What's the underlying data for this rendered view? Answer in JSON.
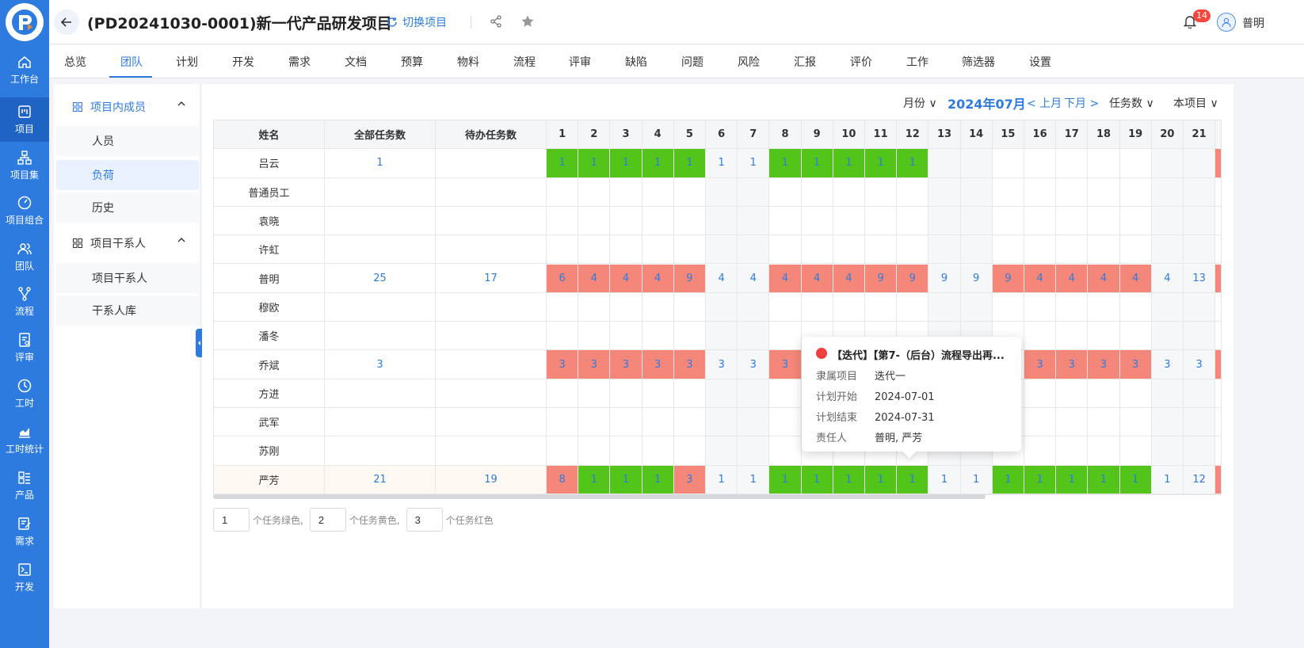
{
  "rail": {
    "items": [
      {
        "label": "工作台",
        "icon": "home-icon"
      },
      {
        "label": "项目",
        "icon": "project-board-icon",
        "active": true
      },
      {
        "label": "项目集",
        "icon": "hierarchy-icon"
      },
      {
        "label": "项目组合",
        "icon": "gauge-icon"
      },
      {
        "label": "团队",
        "icon": "team-icon"
      },
      {
        "label": "流程",
        "icon": "flow-icon"
      },
      {
        "label": "评审",
        "icon": "review-doc-icon"
      },
      {
        "label": "工时",
        "icon": "clock-icon"
      },
      {
        "label": "工时统计",
        "icon": "bar-chart-icon"
      },
      {
        "label": "产品",
        "icon": "product-icon"
      },
      {
        "label": "需求",
        "icon": "edit-doc-icon"
      },
      {
        "label": "开发",
        "icon": "terminal-icon"
      }
    ]
  },
  "header": {
    "title": "(PD20241030-0001)新一代产品研发项目",
    "switch_label": "切换项目",
    "notification_count": "14",
    "user_name": "普明"
  },
  "tabs": [
    "总览",
    "团队",
    "计划",
    "开发",
    "需求",
    "文档",
    "预算",
    "物料",
    "流程",
    "评审",
    "缺陷",
    "问题",
    "风险",
    "汇报",
    "评价",
    "工作",
    "筛选器",
    "设置"
  ],
  "active_tab": "团队",
  "sidebar": {
    "group1": {
      "label": "项目内成员",
      "items": [
        "人员",
        "负荷",
        "历史"
      ]
    },
    "group2": {
      "label": "项目干系人",
      "items": [
        "项目干系人",
        "干系人库"
      ]
    },
    "active_item": "负荷"
  },
  "toolbar": {
    "period": "月份",
    "month": "2024年07月",
    "prev": "< 上月",
    "next": "下月 >",
    "metric": "任务数",
    "scope": "本项目"
  },
  "table": {
    "columns": {
      "name": "姓名",
      "total": "全部任务数",
      "pending": "待办任务数"
    },
    "days": [
      "1",
      "2",
      "3",
      "4",
      "5",
      "6",
      "7",
      "8",
      "9",
      "10",
      "11",
      "12",
      "13",
      "14",
      "15",
      "16",
      "17",
      "18",
      "19",
      "20",
      "21"
    ],
    "weekend_days": [
      6,
      7,
      13,
      14,
      20,
      21
    ],
    "rows": [
      {
        "name": "吕云",
        "total": "1",
        "pending": "",
        "cells": [
          "1",
          "1",
          "1",
          "1",
          "1",
          "1",
          "1",
          "1",
          "1",
          "1",
          "1",
          "1",
          "",
          "",
          "",
          "",
          "",
          "",
          "",
          "",
          ""
        ],
        "colors": [
          "g",
          "g",
          "g",
          "g",
          "g",
          "",
          "",
          "g",
          "g",
          "g",
          "g",
          "g",
          "",
          "",
          "",
          "",
          "",
          "",
          "",
          "",
          ""
        ]
      },
      {
        "name": "普通员工",
        "total": "",
        "pending": "",
        "cells": [],
        "colors": []
      },
      {
        "name": "袁晓",
        "total": "",
        "pending": "",
        "cells": [],
        "colors": []
      },
      {
        "name": "许虹",
        "total": "",
        "pending": "",
        "cells": [],
        "colors": []
      },
      {
        "name": "普明",
        "total": "25",
        "pending": "17",
        "cells": [
          "6",
          "4",
          "4",
          "4",
          "9",
          "4",
          "4",
          "4",
          "4",
          "4",
          "9",
          "9",
          "9",
          "9",
          "9",
          "4",
          "4",
          "4",
          "4",
          "4",
          "13"
        ],
        "colors": [
          "r",
          "r",
          "r",
          "r",
          "r",
          "",
          "",
          "r",
          "r",
          "r",
          "r",
          "r",
          "",
          "",
          "r",
          "r",
          "r",
          "r",
          "r",
          "",
          ""
        ]
      },
      {
        "name": "穆欧",
        "total": "",
        "pending": "",
        "cells": [],
        "colors": []
      },
      {
        "name": "潘冬",
        "total": "",
        "pending": "",
        "cells": [],
        "colors": []
      },
      {
        "name": "乔斌",
        "total": "3",
        "pending": "",
        "cells": [
          "3",
          "3",
          "3",
          "3",
          "3",
          "3",
          "3",
          "3",
          "",
          "",
          "",
          "",
          "",
          "",
          "",
          "3",
          "3",
          "3",
          "3",
          "3",
          "3"
        ],
        "colors": [
          "r",
          "r",
          "r",
          "r",
          "r",
          "",
          "",
          "r",
          "",
          "",
          "",
          "",
          "",
          "",
          "",
          "r",
          "r",
          "r",
          "r",
          "",
          ""
        ]
      },
      {
        "name": "方进",
        "total": "",
        "pending": "",
        "cells": [],
        "colors": []
      },
      {
        "name": "武军",
        "total": "",
        "pending": "",
        "cells": [],
        "colors": []
      },
      {
        "name": "苏刚",
        "total": "",
        "pending": "",
        "cells": [],
        "colors": []
      },
      {
        "name": "严芳",
        "total": "21",
        "pending": "19",
        "cells": [
          "8",
          "1",
          "1",
          "1",
          "3",
          "1",
          "1",
          "1",
          "1",
          "1",
          "1",
          "1",
          "1",
          "1",
          "1",
          "1",
          "1",
          "1",
          "1",
          "1",
          "12"
        ],
        "colors": [
          "r",
          "g",
          "g",
          "g",
          "r",
          "",
          "",
          "g",
          "g",
          "g",
          "g",
          "g",
          "",
          "",
          "g",
          "g",
          "g",
          "g",
          "g",
          "",
          ""
        ]
      }
    ]
  },
  "legend": {
    "green_value": "1",
    "green_text": "个任务绿色,",
    "yellow_value": "2",
    "yellow_text": "个任务黄色,",
    "red_value": "3",
    "red_text": "个任务红色"
  },
  "tooltip": {
    "title": "【迭代】【第7-（后台）流程导出再...",
    "project_label": "隶属项目",
    "project_value": "迭代一",
    "start_label": "计划开始",
    "start_value": "2024-07-01",
    "end_label": "计划结束",
    "end_value": "2024-07-31",
    "owner_label": "责任人",
    "owner_value": "普明, 严芳"
  },
  "colors": {
    "primary": "#2e7be0",
    "green": "#52c41a",
    "red": "#f5877a",
    "badge": "#f5483d"
  }
}
